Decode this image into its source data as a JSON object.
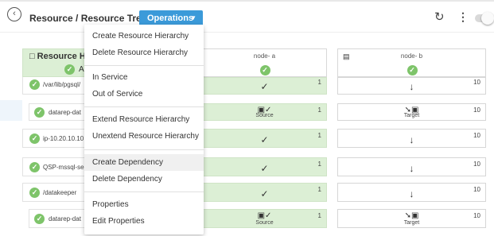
{
  "header": {
    "breadcrumb": "Resource / Resource Tree",
    "operations_label": "Operations"
  },
  "menu": {
    "items": [
      "Create Resource Hierarchy",
      "Delete Resource Hierarchy",
      "In Service",
      "Out of Service",
      "Extend Resource Hierarchy",
      "Unextend Resource Hierarchy",
      "Create Dependency",
      "Delete Dependency",
      "Properties",
      "Edit Properties"
    ],
    "highlighted": "Create Dependency"
  },
  "table": {
    "resource_header": "Resource H",
    "resource_header_sub": "A",
    "nodes": [
      "node- a",
      "node- b"
    ],
    "rows": [
      {
        "label": "/var/lib/pgsql/",
        "a": {
          "prio": "1",
          "role": ""
        },
        "b": {
          "prio": "10",
          "role": ""
        }
      },
      {
        "label": "datarep-dat",
        "a": {
          "prio": "1",
          "role": "Source"
        },
        "b": {
          "prio": "10",
          "role": "Target"
        }
      },
      {
        "label": "ip-10.20.10.10",
        "a": {
          "prio": "1",
          "role": ""
        },
        "b": {
          "prio": "10",
          "role": ""
        }
      },
      {
        "label": "QSP-mssql-se",
        "a": {
          "prio": "1",
          "role": ""
        },
        "b": {
          "prio": "10",
          "role": ""
        }
      },
      {
        "label": "/datakeeper",
        "a": {
          "prio": "1",
          "role": ""
        },
        "b": {
          "prio": "10",
          "role": ""
        }
      },
      {
        "label": "datarep-dat",
        "a": {
          "prio": "1",
          "role": "Source"
        },
        "b": {
          "prio": "10",
          "role": "Target"
        }
      }
    ]
  },
  "icons": {
    "back": "chevron-left-icon",
    "refresh": "refresh-icon",
    "more": "kebab-icon",
    "check": "check-circle-icon",
    "checkmark": "checkmark-icon",
    "down": "arrow-down-icon",
    "source": "source-icon",
    "target": "target-icon"
  }
}
